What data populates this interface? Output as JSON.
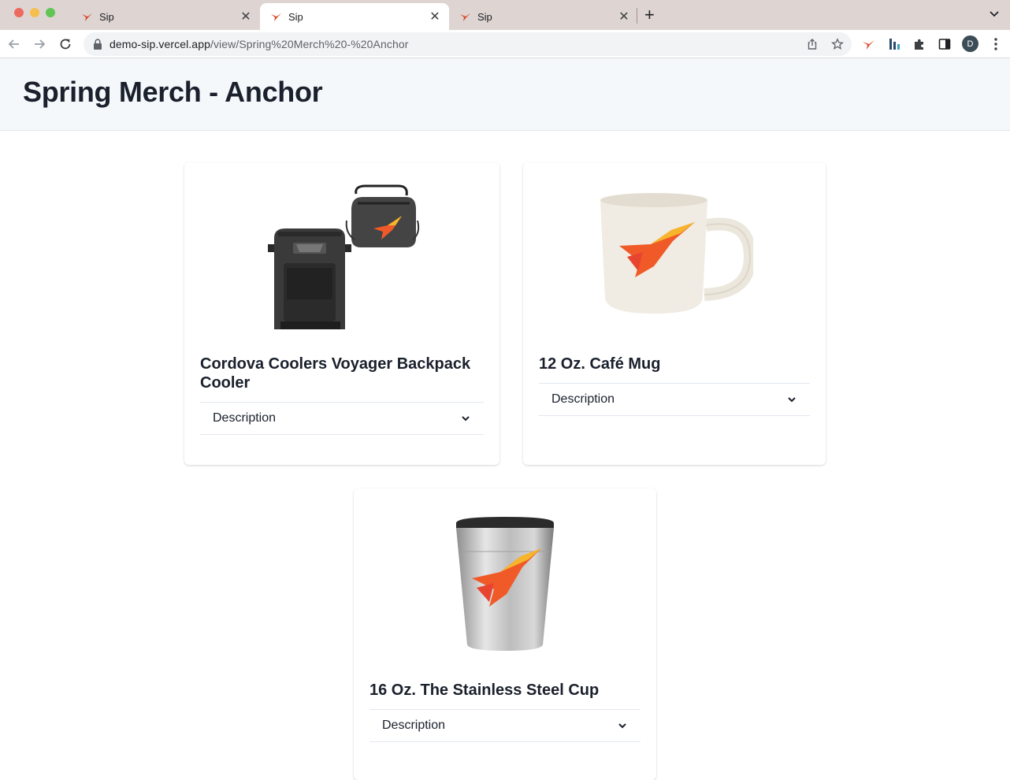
{
  "browser": {
    "tabs": [
      {
        "title": "Sip",
        "active": false
      },
      {
        "title": "Sip",
        "active": true
      },
      {
        "title": "Sip",
        "active": false
      }
    ],
    "url_host": "demo-sip.vercel.app",
    "url_path": "/view/Spring%20Merch%20-%20Anchor",
    "profile_initial": "D"
  },
  "page": {
    "title": "Spring Merch - Anchor"
  },
  "products": [
    {
      "name": "Cordova Coolers Voyager Backpack Cooler",
      "accordion_label": "Description"
    },
    {
      "name": "12 Oz. Café Mug",
      "accordion_label": "Description"
    },
    {
      "name": "16 Oz. The Stainless Steel Cup",
      "accordion_label": "Description"
    }
  ],
  "colors": {
    "brand_orange": "#f05a28",
    "brand_yellow": "#f7b52b",
    "header_bg": "#f5f8fb"
  }
}
